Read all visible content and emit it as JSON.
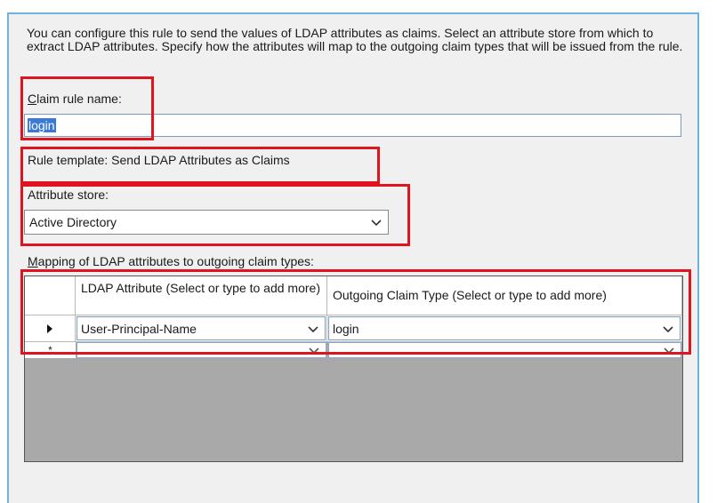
{
  "description": "You can configure this rule to send the values of LDAP attributes as claims. Select an attribute store from which to extract LDAP attributes. Specify how the attributes will map to the outgoing claim types that will be issued from the rule.",
  "claim_rule_name": {
    "label": "Claim rule name:",
    "value": "login"
  },
  "rule_template": "Rule template: Send LDAP Attributes as Claims",
  "attribute_store": {
    "label": "Attribute store:",
    "selected": "Active Directory"
  },
  "mapping": {
    "label": "Mapping of LDAP attributes to outgoing claim types:",
    "columns": [
      "LDAP Attribute (Select or type to add more)",
      "Outgoing Claim Type (Select or type to add more)"
    ],
    "rows": [
      {
        "ldap_attribute": "User-Principal-Name",
        "claim_type": "login"
      }
    ],
    "new_row_marker": "*"
  },
  "colors": {
    "highlight_border": "#e0141e",
    "selection": "#3a7ad7",
    "frame_border": "#6fb3e0",
    "grid_background": "#a9a9a9"
  },
  "icons": {
    "dropdown": "chevron-down-icon",
    "current_row": "row-pointer-icon"
  }
}
